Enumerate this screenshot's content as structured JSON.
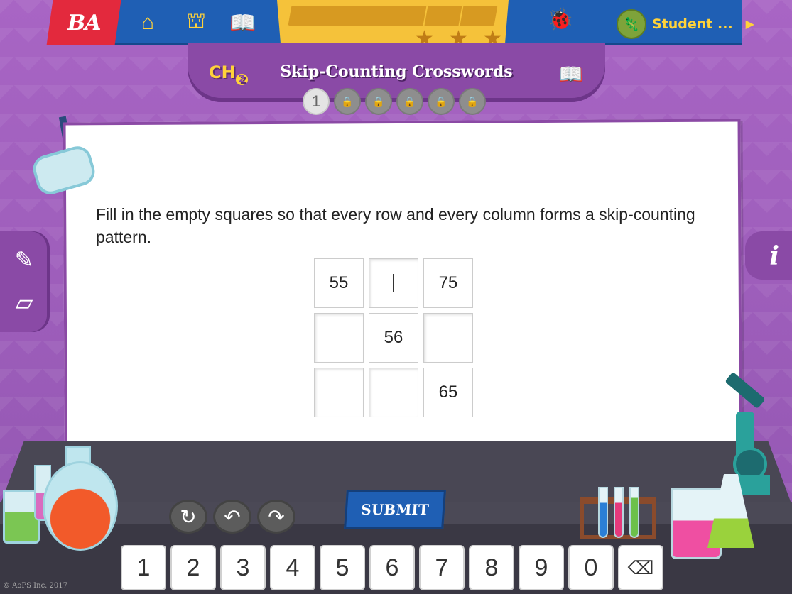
{
  "nav": {
    "brand": "BA",
    "student_name": "Student ...",
    "stars_count": 3
  },
  "chapter": {
    "label": "CH",
    "number": "2",
    "title": "Skip-Counting Crosswords",
    "current_problem": "1",
    "locked_count": 5
  },
  "problem": {
    "instructions": "Fill in the empty squares so that every row and every column forms a skip-counting pattern.",
    "grid": [
      [
        "55",
        "",
        "75"
      ],
      [
        "",
        "56",
        ""
      ],
      [
        "",
        "",
        "65"
      ]
    ],
    "active_cell": [
      0,
      1
    ]
  },
  "controls": {
    "submit_label": "SUBMIT",
    "keys": [
      "1",
      "2",
      "3",
      "4",
      "5",
      "6",
      "7",
      "8",
      "9",
      "0"
    ]
  },
  "footer": {
    "copyright": "© AoPS Inc. 2017"
  },
  "colors": {
    "background": "#9b5cb8",
    "topbar": "#1f5fb4",
    "brand": "#e3293d",
    "accent": "#ffd23a",
    "progress": "#f5c23a"
  }
}
